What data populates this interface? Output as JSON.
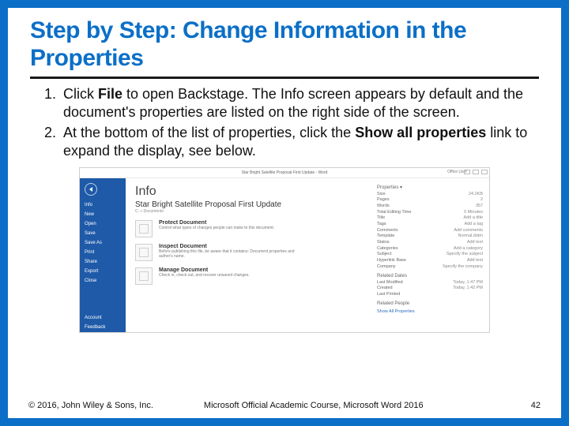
{
  "title": "Step by Step: Change Information in the Properties",
  "steps": {
    "s1_a": "Click ",
    "s1_b": "File",
    "s1_c": " to open Backstage. The Info screen appears by default and the document's properties are listed on the right side of the screen.",
    "s2_a": "At the bottom of the list of properties, click the ",
    "s2_b": "Show all properties",
    "s2_c": " link to expand the display, see below."
  },
  "mock": {
    "titlebar": "Star Bright Satellite Proposal First Update - Word",
    "user": "Office User",
    "sidebar": [
      "Info",
      "New",
      "Open",
      "Save",
      "Save As",
      "Print",
      "Share",
      "Export",
      "Close",
      "Account",
      "Feedback"
    ],
    "info_heading": "Info",
    "doc_title": "Star Bright Satellite Proposal First Update",
    "doc_path": "C: » Documents",
    "sections": {
      "protect_h": "Protect Document",
      "protect_p": "Control what types of changes people can make to this document.",
      "inspect_h": "Inspect Document",
      "inspect_p": "Before publishing this file, be aware that it contains: Document properties and author's name.",
      "manage_h": "Manage Document",
      "manage_p": "Check in, check out, and recover unsaved changes."
    },
    "props": {
      "heading": "Properties ▾",
      "rows": [
        {
          "k": "Size",
          "v": "24.2KB"
        },
        {
          "k": "Pages",
          "v": "2"
        },
        {
          "k": "Words",
          "v": "357"
        },
        {
          "k": "Total Editing Time",
          "v": "5 Minutes"
        },
        {
          "k": "Title",
          "v": "Add a title"
        },
        {
          "k": "Tags",
          "v": "Add a tag"
        },
        {
          "k": "Comments",
          "v": "Add comments"
        },
        {
          "k": "Template",
          "v": "Normal.dotm"
        },
        {
          "k": "Status",
          "v": "Add text"
        },
        {
          "k": "Categories",
          "v": "Add a category"
        },
        {
          "k": "Subject",
          "v": "Specify the subject"
        },
        {
          "k": "Hyperlink Base",
          "v": "Add text"
        },
        {
          "k": "Company",
          "v": "Specify the company"
        }
      ],
      "dates_h": "Related Dates",
      "dates": [
        {
          "k": "Last Modified",
          "v": "Today, 1:47 PM"
        },
        {
          "k": "Created",
          "v": "Today, 1:42 PM"
        },
        {
          "k": "Last Printed",
          "v": ""
        }
      ],
      "people_h": "Related People",
      "link": "Show All Properties"
    }
  },
  "footer": {
    "left": "© 2016, John Wiley & Sons, Inc.",
    "mid": "Microsoft Official Academic Course, Microsoft Word 2016",
    "page": "42"
  }
}
